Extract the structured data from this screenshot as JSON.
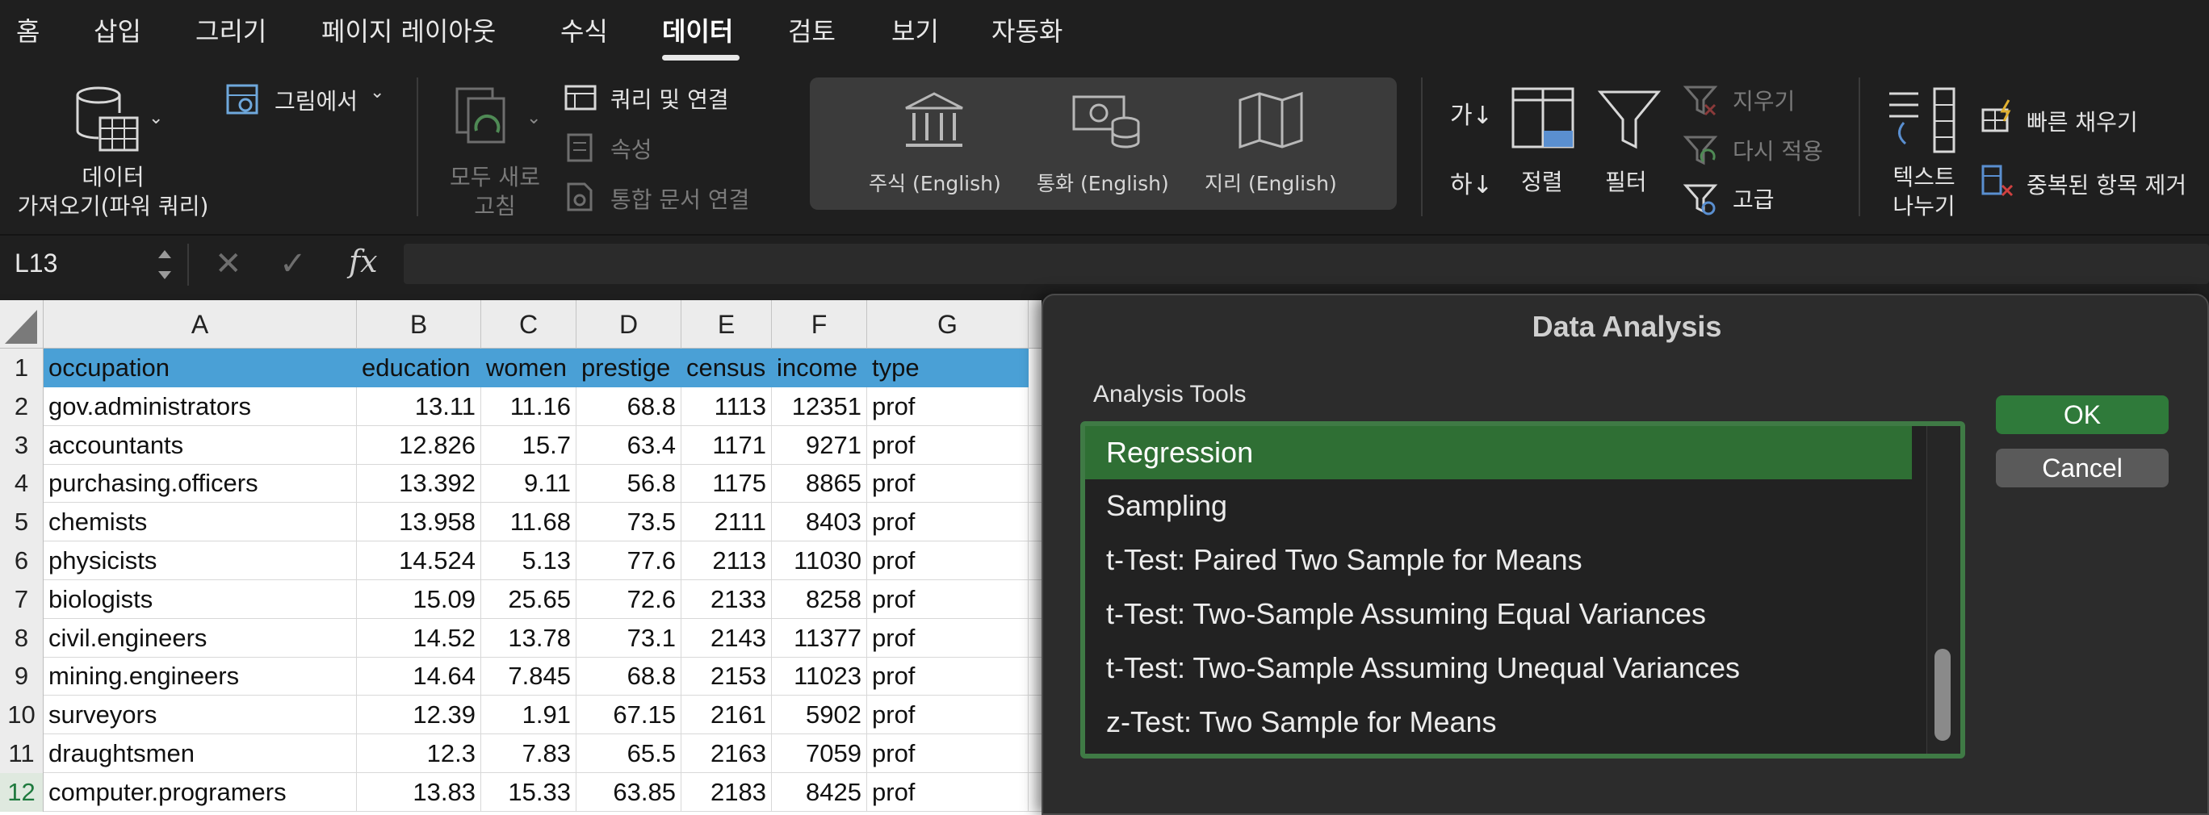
{
  "ribbon_tabs": [
    "홈",
    "삽입",
    "그리기",
    "페이지 레이아웃",
    "수식",
    "데이터",
    "검토",
    "보기",
    "자동화"
  ],
  "active_tab": "데이터",
  "ribbon": {
    "get_data_line1": "데이터",
    "get_data_line2": "가져오기(파워 쿼리)",
    "from_picture": "그림에서",
    "refresh_all_line1": "모두 새로",
    "refresh_all_line2": "고침",
    "queries_connections": "쿼리 및 연결",
    "properties": "속성",
    "edit_links": "통합 문서 연결",
    "stocks": "주식 (English)",
    "currencies": "통화 (English)",
    "geography": "지리 (English)",
    "sort_az": "가↓",
    "sort_za": "하↓",
    "sort": "정렬",
    "filter": "필터",
    "clear": "지우기",
    "reapply": "다시 적용",
    "advanced": "고급",
    "text_to_columns_line1": "텍스트",
    "text_to_columns_line2": "나누기",
    "flash_fill": "빠른 채우기",
    "remove_duplicates": "중복된 항목 제거"
  },
  "formula_bar": {
    "name_box": "L13",
    "fx": "fx",
    "formula": ""
  },
  "sheet": {
    "columns": [
      "A",
      "B",
      "C",
      "D",
      "E",
      "F",
      "G"
    ],
    "header": [
      "occupation",
      "education",
      "women",
      "prestige",
      "census",
      "income",
      "type"
    ],
    "rows": [
      [
        "gov.administrators",
        "13.11",
        "11.16",
        "68.8",
        "1113",
        "12351",
        "prof"
      ],
      [
        "accountants",
        "12.826",
        "15.7",
        "63.4",
        "1171",
        "9271",
        "prof"
      ],
      [
        "purchasing.officers",
        "13.392",
        "9.11",
        "56.8",
        "1175",
        "8865",
        "prof"
      ],
      [
        "chemists",
        "13.958",
        "11.68",
        "73.5",
        "2111",
        "8403",
        "prof"
      ],
      [
        "physicists",
        "14.524",
        "5.13",
        "77.6",
        "2113",
        "11030",
        "prof"
      ],
      [
        "biologists",
        "15.09",
        "25.65",
        "72.6",
        "2133",
        "8258",
        "prof"
      ],
      [
        "civil.engineers",
        "14.52",
        "13.78",
        "73.1",
        "2143",
        "11377",
        "prof"
      ],
      [
        "mining.engineers",
        "14.64",
        "7.845",
        "68.8",
        "2153",
        "11023",
        "prof"
      ],
      [
        "surveyors",
        "12.39",
        "1.91",
        "67.15",
        "2161",
        "5902",
        "prof"
      ],
      [
        "draughtsmen",
        "12.3",
        "7.83",
        "65.5",
        "2163",
        "7059",
        "prof"
      ],
      [
        "computer.programers",
        "13.83",
        "15.33",
        "63.85",
        "2183",
        "8425",
        "prof"
      ]
    ],
    "row_numbers": [
      "1",
      "2",
      "3",
      "4",
      "5",
      "6",
      "7",
      "8",
      "9",
      "10",
      "11",
      "12"
    ]
  },
  "dialog": {
    "title": "Data Analysis",
    "tools_label": "Analysis Tools",
    "items": [
      "Regression",
      "Sampling",
      "t-Test: Paired Two Sample for Means",
      "t-Test: Two-Sample Assuming Equal Variances",
      "t-Test: Two-Sample Assuming Unequal Variances",
      "z-Test: Two Sample for Means"
    ],
    "selected_item": "Regression",
    "ok": "OK",
    "cancel": "Cancel"
  },
  "colors": {
    "header_fill": "#4aa0d6",
    "selection_green": "#2f6f34",
    "ok_button": "#2f7a3a"
  }
}
